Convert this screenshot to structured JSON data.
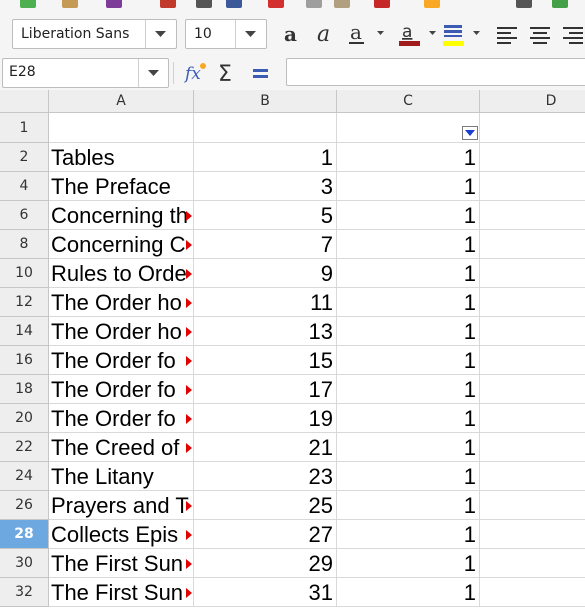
{
  "toolbar": {
    "font_name": "Liberation Sans",
    "font_size": "10",
    "font_color": "#a01c1c",
    "highlight_color": "#ffff00"
  },
  "formula_bar": {
    "name_box": "E28",
    "formula": ""
  },
  "columns": [
    "A",
    "B",
    "C",
    "D"
  ],
  "row1_label": "1",
  "rows": [
    {
      "row": "2",
      "a": "Tables",
      "b": "1",
      "c": "1",
      "overflow": false
    },
    {
      "row": "4",
      "a": "The Preface",
      "b": "3",
      "c": "1",
      "overflow": false
    },
    {
      "row": "6",
      "a": "Concerning th",
      "b": "5",
      "c": "1",
      "overflow": true
    },
    {
      "row": "8",
      "a": "Concerning C",
      "b": "7",
      "c": "1",
      "overflow": true
    },
    {
      "row": "10",
      "a": "Rules to Orde",
      "b": "9",
      "c": "1",
      "overflow": true
    },
    {
      "row": "12",
      "a": "The Order ho",
      "b": "11",
      "c": "1",
      "overflow": true
    },
    {
      "row": "14",
      "a": "The Order ho",
      "b": "13",
      "c": "1",
      "overflow": true
    },
    {
      "row": "16",
      "a": "The Order fo",
      "b": "15",
      "c": "1",
      "overflow": true
    },
    {
      "row": "18",
      "a": "The Order fo",
      "b": "17",
      "c": "1",
      "overflow": true
    },
    {
      "row": "20",
      "a": "The Order fo",
      "b": "19",
      "c": "1",
      "overflow": true
    },
    {
      "row": "22",
      "a": "The Creed of",
      "b": "21",
      "c": "1",
      "overflow": true
    },
    {
      "row": "24",
      "a": "The Litany",
      "b": "23",
      "c": "1",
      "overflow": false
    },
    {
      "row": "26",
      "a": "Prayers and T",
      "b": "25",
      "c": "1",
      "overflow": true
    },
    {
      "row": "28",
      "a": "Collects Epis",
      "b": "27",
      "c": "1",
      "overflow": true
    },
    {
      "row": "30",
      "a": "The First Sun",
      "b": "29",
      "c": "1",
      "overflow": true
    },
    {
      "row": "32",
      "a": "The First Sun",
      "b": "31",
      "c": "1",
      "overflow": true
    }
  ],
  "selected_row": "28"
}
